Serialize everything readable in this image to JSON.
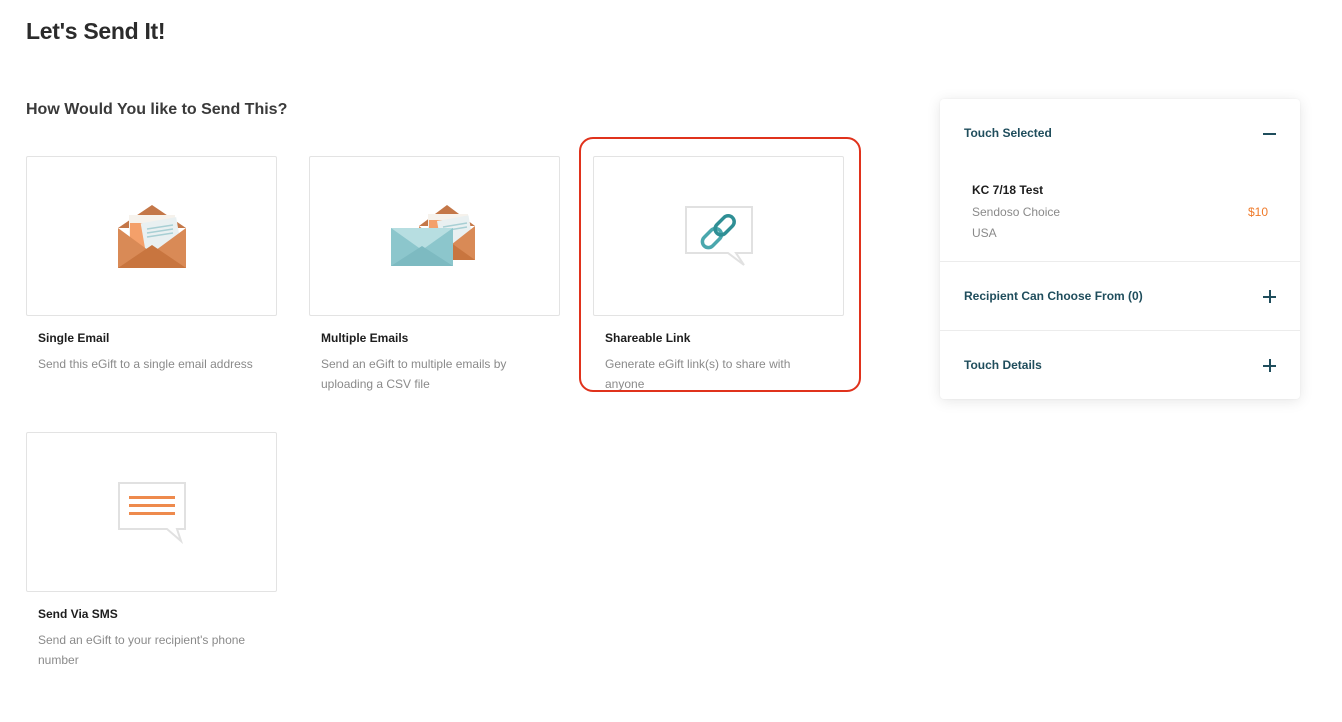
{
  "page": {
    "title": "Let's Send It!",
    "section_title": "How Would You like to Send This?"
  },
  "options": [
    {
      "title": "Single Email",
      "description": "Send this eGift to a single email address",
      "icon": "open-envelope-icon"
    },
    {
      "title": "Multiple Emails",
      "description": "Send an eGift to multiple emails by uploading a CSV file",
      "icon": "multiple-envelopes-icon"
    },
    {
      "title": "Shareable Link",
      "description": "Generate eGift link(s) to share with anyone",
      "icon": "chain-link-icon",
      "highlighted": true
    },
    {
      "title": "Send Via SMS",
      "description": "Send an eGift to your recipient's phone number",
      "icon": "sms-message-icon"
    }
  ],
  "panel": {
    "touch_selected": {
      "label": "Touch Selected",
      "expanded": true,
      "name": "KC 7/18 Test",
      "vendor": "Sendoso Choice",
      "country": "USA",
      "price": "$10"
    },
    "recipient_choose": {
      "label": "Recipient Can Choose From (0)",
      "expanded": false
    },
    "touch_details": {
      "label": "Touch Details",
      "expanded": false
    }
  },
  "colors": {
    "highlight": "#e0321c",
    "accent_teal": "#1f4d5c",
    "price_orange": "#ef7a2a",
    "envelope_orange": "#d97f4e",
    "envelope_blue": "#8cc6cc"
  }
}
